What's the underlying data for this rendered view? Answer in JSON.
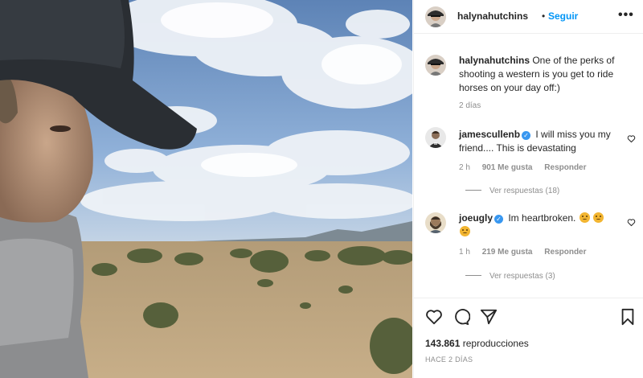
{
  "post": {
    "username": "halynahutchins",
    "separator": "•",
    "follow_label": "Seguir",
    "more_label": "•••",
    "caption_text": " One of the perks of shooting a western is you get to ride horses on your day off:)",
    "caption_time": "2 días"
  },
  "comments": [
    {
      "username": "jamescullenb",
      "text": " I will miss you my friend.... This is devastating",
      "time": "2 h",
      "likes": "901 Me gusta",
      "reply_label": "Responder",
      "view_replies": "Ver respuestas (18)"
    },
    {
      "username": "joeugly",
      "text": " Im heartbroken. ",
      "time": "1 h",
      "likes": "219 Me gusta",
      "reply_label": "Responder",
      "view_replies": "Ver respuestas (3)"
    }
  ],
  "footer": {
    "views_count": "143.861",
    "views_label": " reproducciones",
    "posted": "HACE 2 DÍAS"
  },
  "icons": {
    "verified": "verified-badge-icon",
    "like": "heart-icon",
    "comment": "comment-bubble-icon",
    "share": "paper-plane-icon",
    "save": "bookmark-icon",
    "emoji": "worried-face-emoji"
  },
  "colors": {
    "accent": "#0095f6",
    "verified": "#3897f0",
    "meta": "#8e8e8e",
    "text": "#262626"
  }
}
